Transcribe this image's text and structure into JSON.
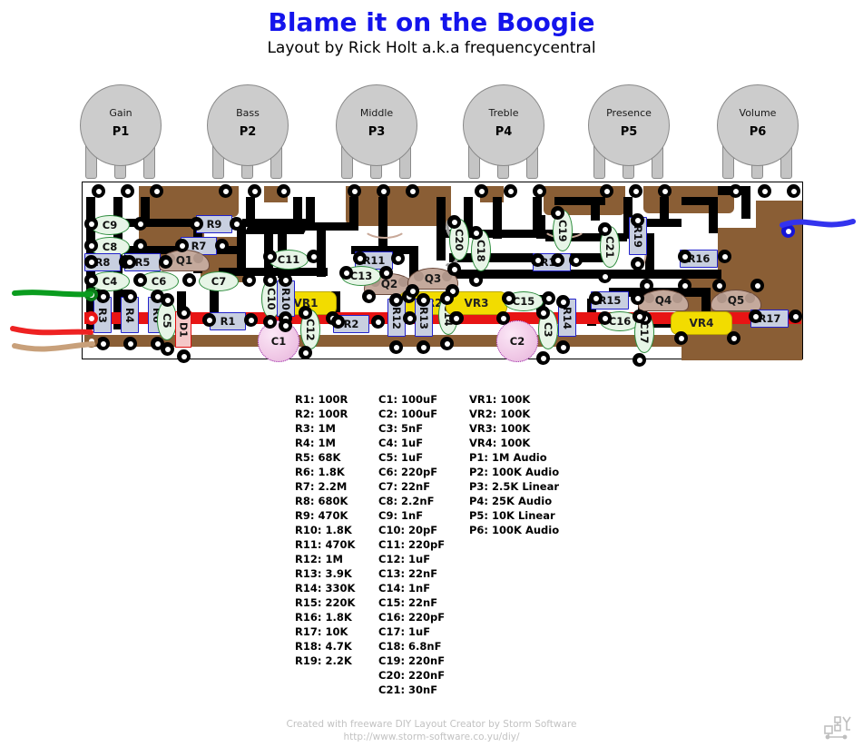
{
  "title": {
    "main": "Blame it on the Boogie",
    "subtitle": "Layout by Rick Holt a.k.a frequencycentral",
    "main_color": "#1414ec"
  },
  "pots": [
    {
      "name": "Gain",
      "id": "P1"
    },
    {
      "name": "Bass",
      "id": "P2"
    },
    {
      "name": "Middle",
      "id": "P3"
    },
    {
      "name": "Treble",
      "id": "P4"
    },
    {
      "name": "Presence",
      "id": "P5"
    },
    {
      "name": "Volume",
      "id": "P6"
    }
  ],
  "board": {
    "copper_color": "#8a5e35",
    "trace_color": "#000000",
    "power_rail_color": "#e81414",
    "ground_rail_color": "#8a5e35",
    "resistors": [
      "R1",
      "R2",
      "R3",
      "R4",
      "R5",
      "R6",
      "R7",
      "R8",
      "R9",
      "R10",
      "R11",
      "R12",
      "R13",
      "R14",
      "R15",
      "R16",
      "R17",
      "R18",
      "R19"
    ],
    "capacitors": [
      "C1",
      "C2",
      "C3",
      "C4",
      "C5",
      "C6",
      "C7",
      "C8",
      "C9",
      "C10",
      "C11",
      "C12",
      "C13",
      "C14",
      "C15",
      "C16",
      "C17",
      "C18",
      "C19",
      "C20",
      "C21"
    ],
    "trimmers": [
      "VR1",
      "VR2",
      "VR3",
      "VR4"
    ],
    "transistors": [
      "Q1",
      "Q2",
      "Q3",
      "Q4",
      "Q5"
    ],
    "diodes": [
      "D1"
    ],
    "wires": [
      {
        "name": "input-wire-green",
        "color": "#0a9c1e"
      },
      {
        "name": "power-wire-red",
        "color": "#ee2222"
      },
      {
        "name": "ground-wire-brown",
        "color": "#c8a07a"
      },
      {
        "name": "output-wire-blue",
        "color": "#3333ee"
      }
    ]
  },
  "bom": {
    "resistors": [
      "R1: 100R",
      "R2: 100R",
      "R3: 1M",
      "R4: 1M",
      "R5: 68K",
      "R6: 1.8K",
      "R7: 2.2M",
      "R8: 680K",
      "R9: 470K",
      "R10: 1.8K",
      "R11: 470K",
      "R12: 1M",
      "R13: 3.9K",
      "R14: 330K",
      "R15: 220K",
      "R16: 1.8K",
      "R17: 10K",
      "R18: 4.7K",
      "R19: 2.2K"
    ],
    "capacitors": [
      "C1: 100uF",
      "C2: 100uF",
      "C3: 5nF",
      "C4: 1uF",
      "C5: 1uF",
      "C6: 220pF",
      "C7: 22nF",
      "C8: 2.2nF",
      "C9: 1nF",
      "C10: 20pF",
      "C11: 220pF",
      "C12: 1uF",
      "C13: 22nF",
      "C14: 1nF",
      "C15: 22nF",
      "C16: 220pF",
      "C17: 1uF",
      "C18: 6.8nF",
      "C19: 220nF",
      "C20: 220nF",
      "C21: 30nF"
    ],
    "others": [
      "VR1: 100K",
      "VR2: 100K",
      "VR3: 100K",
      "VR4: 100K",
      "P1: 1M Audio",
      "P2: 100K Audio",
      "P3: 2.5K Linear",
      "P4: 25K Audio",
      "P5: 10K Linear",
      "P6: 100K Audio"
    ]
  },
  "footer": {
    "line1": "Created with freeware DIY Layout Creator by Storm Software",
    "line2": "http://www.storm-software.co.yu/diy/"
  }
}
